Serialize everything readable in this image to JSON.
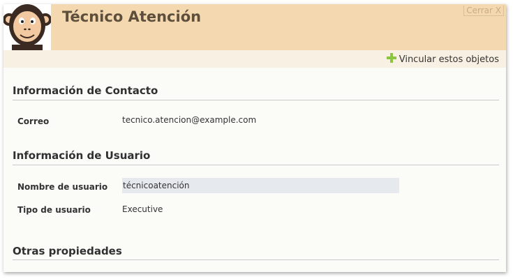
{
  "header": {
    "title": "Técnico Atención",
    "close_label": "Cerrar X"
  },
  "toolbar": {
    "link_label": "Vincular estos objetos"
  },
  "contact": {
    "section_title": "Información de Contacto",
    "email_label": "Correo",
    "email_value": "tecnico.atencion@example.com"
  },
  "user": {
    "section_title": "Información de Usuario",
    "username_label": "Nombre de usuario",
    "username_value": "técnicoatención",
    "type_label": "Tipo de usuario",
    "type_value": "Executive"
  },
  "other": {
    "section_title": "Otras propiedades"
  },
  "colors": {
    "header_bg": "#f4d9b0",
    "toolbar_bg": "#f8f0e2",
    "plus_icon": "#8cc63e"
  }
}
